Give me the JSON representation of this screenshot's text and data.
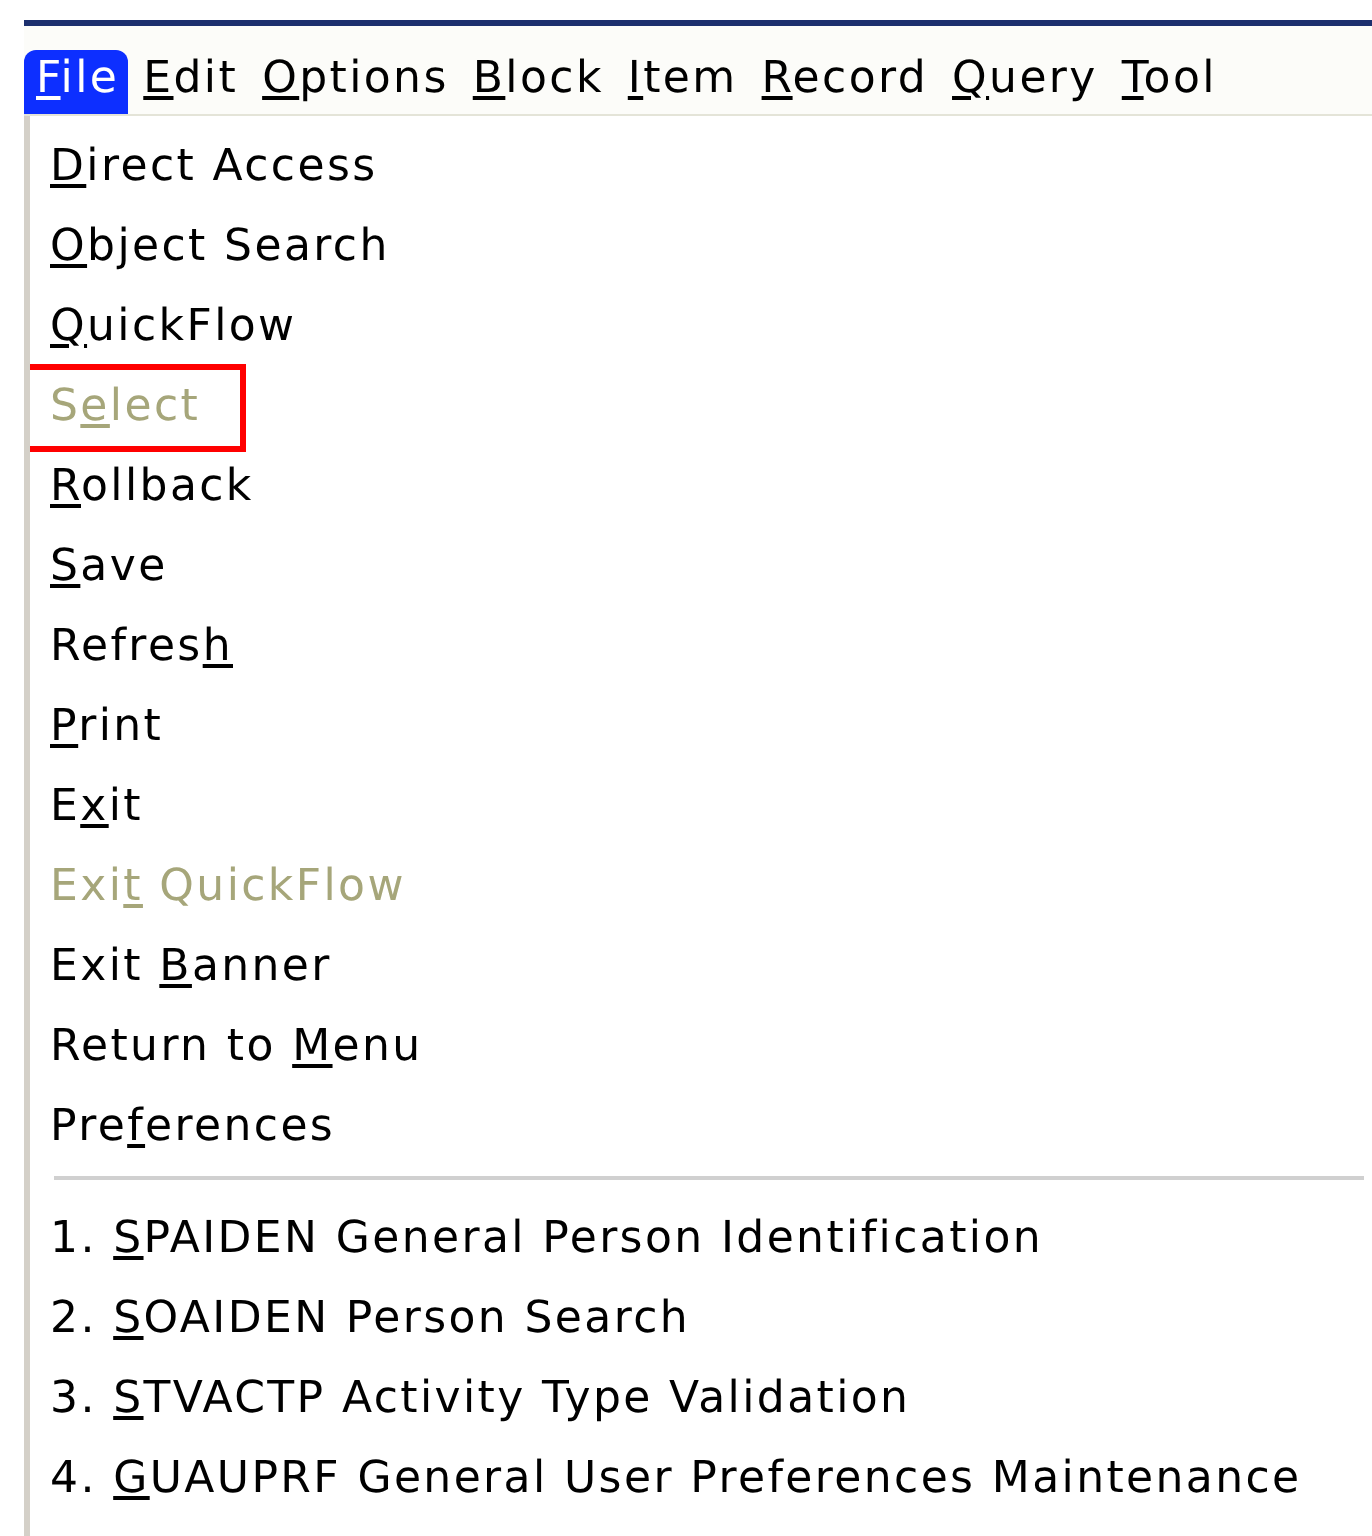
{
  "menu_bar": [
    {
      "key": "F",
      "after": "ile",
      "selected": true
    },
    {
      "key": "E",
      "after": "dit",
      "selected": false
    },
    {
      "key": "O",
      "after": "ptions",
      "selected": false
    },
    {
      "key": "B",
      "after": "lock",
      "selected": false
    },
    {
      "key": "I",
      "after": "tem",
      "selected": false
    },
    {
      "key": "R",
      "after": "ecord",
      "selected": false
    },
    {
      "key": "Q",
      "after": "uery",
      "selected": false
    },
    {
      "key": "T",
      "after": "ool",
      "selected": false
    }
  ],
  "file_menu": {
    "items": [
      {
        "key": "D",
        "after": "irect Access",
        "disabled": false,
        "highlighted": false
      },
      {
        "key": "O",
        "after": "bject Search",
        "disabled": false,
        "highlighted": false
      },
      {
        "key": "Q",
        "after": "uickFlow",
        "disabled": false,
        "highlighted": false
      },
      {
        "before": "S",
        "key": "e",
        "after": "lect",
        "disabled": true,
        "highlighted": true
      },
      {
        "key": "R",
        "after": "ollback",
        "disabled": false,
        "highlighted": false
      },
      {
        "key": "S",
        "after": "ave",
        "disabled": false,
        "highlighted": false
      },
      {
        "before": "Refres",
        "key": "h",
        "disabled": false,
        "highlighted": false
      },
      {
        "key": "P",
        "after": "rint",
        "disabled": false,
        "highlighted": false
      },
      {
        "before": "E",
        "key": "x",
        "after": "it",
        "disabled": false,
        "highlighted": false
      },
      {
        "before": "Exi",
        "key": "t",
        "after": " QuickFlow",
        "disabled": true,
        "highlighted": false
      },
      {
        "before": "Exit ",
        "key": "B",
        "after": "anner",
        "disabled": false,
        "highlighted": false
      },
      {
        "before": "Return to ",
        "key": "M",
        "after": "enu",
        "disabled": false,
        "highlighted": false
      },
      {
        "before": "Pre",
        "key": "f",
        "after": "erences",
        "disabled": false,
        "highlighted": false
      }
    ],
    "recent": [
      {
        "before": "1. ",
        "key": "S",
        "after": "PAIDEN General Person Identification",
        "disabled": false,
        "highlighted": false
      },
      {
        "before": "2. ",
        "key": "S",
        "after": "OAIDEN Person Search",
        "disabled": false,
        "highlighted": false
      },
      {
        "before": "3. ",
        "key": "S",
        "after": "TVACTP Activity Type Validation",
        "disabled": false,
        "highlighted": false
      },
      {
        "before": "4. ",
        "key": "G",
        "after": "UAUPRF General User Preferences Maintenance",
        "disabled": false,
        "highlighted": false
      }
    ]
  }
}
